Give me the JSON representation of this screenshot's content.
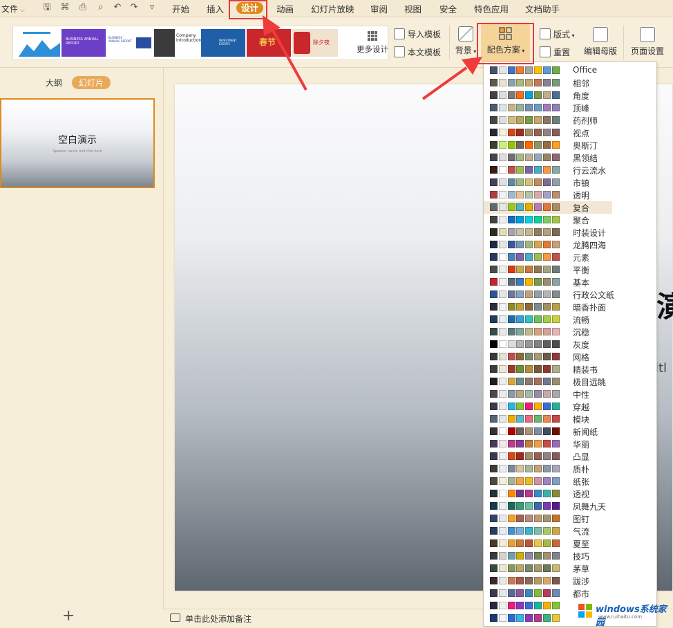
{
  "menubar": {
    "file_label": "文件",
    "items": [
      "开始",
      "插入",
      "设计",
      "动画",
      "幻灯片放映",
      "审阅",
      "视图",
      "安全",
      "特色应用",
      "文档助手"
    ],
    "active_item": "设计"
  },
  "ribbon": {
    "templates": [
      {
        "bg": "#ffffff",
        "accent": "#2f8fd8"
      },
      {
        "bg": "#6c3fc7",
        "accent": "#b48cf0",
        "text": "BUSINESS ANNUAL REPORT"
      },
      {
        "bg": "#ffffff",
        "accent": "#2b4ea0",
        "text": "BUSINESS ANNUAL REPORT"
      },
      {
        "bg": "#3b3b3b",
        "accent": "#ffffff",
        "text": "Company Introduction"
      },
      {
        "bg": "#1f5fa8",
        "accent": "#5fb0e8",
        "text": "INVESTMENT EVENTS"
      },
      {
        "bg": "#c9272c",
        "accent": "#f6c24a",
        "text": "春节"
      },
      {
        "bg": "#f0e2cf",
        "accent": "#c9272c",
        "text": "除夕夜"
      }
    ],
    "more_design": "更多设计",
    "import_template": "导入模板",
    "text_template": "本文模板",
    "background": "背景",
    "color_scheme": "配色方案",
    "layout": "版式",
    "reset": "重置",
    "edit_master": "编辑母版",
    "page_setup": "页面设置"
  },
  "left_pane": {
    "tab_outline": "大纲",
    "tab_slides": "幻灯片",
    "thumb_title": "空白演示",
    "thumb_subtitle": "Speaker name and title here",
    "add_icon": "plus-icon"
  },
  "slide_edge_text1": "演",
  "slide_edge_text2": "itl",
  "notes_placeholder": "单击此处添加备注",
  "watermark": {
    "text": "windows系统家园",
    "url": "www.ruihaitu.com"
  },
  "color_schemes": [
    {
      "name": "Office",
      "colors": [
        "#44546a",
        "#e7e6e6",
        "#4472c4",
        "#ed7d31",
        "#a5a5a5",
        "#ffc000",
        "#5b9bd5",
        "#70ad47"
      ]
    },
    {
      "name": "相邻",
      "colors": [
        "#5d5b4f",
        "#e8e3cf",
        "#8aa2a9",
        "#a9b97a",
        "#c4a776",
        "#c27a58",
        "#8a7f93",
        "#7a9a7a"
      ]
    },
    {
      "name": "角度",
      "colors": [
        "#434242",
        "#dddddd",
        "#797b7e",
        "#f96a1b",
        "#08a1d9",
        "#7c984a",
        "#c2ad8d",
        "#506e94"
      ]
    },
    {
      "name": "顶峰",
      "colors": [
        "#4e5b6f",
        "#dfe3e5",
        "#c9b583",
        "#97b19b",
        "#7a8fb6",
        "#6e9bc1",
        "#a47ab8",
        "#8e7fb6"
      ]
    },
    {
      "name": "药剂师",
      "colors": [
        "#464646",
        "#dedede",
        "#d0bd7f",
        "#b7a85b",
        "#7c9a4c",
        "#c6a86a",
        "#8c7561",
        "#6a7f7e"
      ]
    },
    {
      "name": "视点",
      "colors": [
        "#292934",
        "#f3f2dc",
        "#d34817",
        "#9b2d1f",
        "#a28e6a",
        "#956251",
        "#918485",
        "#855d5d"
      ]
    },
    {
      "name": "奥斯汀",
      "colors": [
        "#3e3d2d",
        "#caf278",
        "#94c600",
        "#71685a",
        "#ff6700",
        "#909465",
        "#956b43",
        "#fea022"
      ]
    },
    {
      "name": "黑领结",
      "colors": [
        "#46464a",
        "#dddddd",
        "#6f6f74",
        "#a7b789",
        "#beae98",
        "#92a9b9",
        "#9c8265",
        "#8d6974"
      ]
    },
    {
      "name": "行云流水",
      "colors": [
        "#3a1e12",
        "#ffffff",
        "#c0504d",
        "#9bbb59",
        "#8064a2",
        "#4bacc6",
        "#f79646",
        "#8ba8a8"
      ]
    },
    {
      "name": "市镇",
      "colors": [
        "#424456",
        "#dee0e5",
        "#5d8aa8",
        "#a2b97e",
        "#d4c07f",
        "#c38d5c",
        "#7e6b96",
        "#93a0a8"
      ]
    },
    {
      "name": "透明",
      "colors": [
        "#b13f3f",
        "#f2f2f2",
        "#9fb8cd",
        "#e8c19b",
        "#b1c5a0",
        "#d9a9a9",
        "#a6a2c8",
        "#bb8f6a"
      ]
    },
    {
      "name": "复合",
      "colors": [
        "#5c6b6f",
        "#e3e7e8",
        "#98c723",
        "#59b0b9",
        "#deae00",
        "#b77bb4",
        "#e0773c",
        "#a98d63"
      ]
    },
    {
      "name": "聚合",
      "colors": [
        "#424242",
        "#eeeeee",
        "#0f6fc6",
        "#009dd9",
        "#0bd0d9",
        "#10cf9b",
        "#7cca62",
        "#a5c249"
      ]
    },
    {
      "name": "时装设计",
      "colors": [
        "#2f2b20",
        "#dfdcb7",
        "#a5a5a5",
        "#c9c2a6",
        "#c4b690",
        "#8e7f5f",
        "#b0a281",
        "#7a6a52"
      ]
    },
    {
      "name": "龙腾四海",
      "colors": [
        "#1f2a44",
        "#e7e6e6",
        "#3b5998",
        "#7896b8",
        "#a3b47d",
        "#d5a64b",
        "#e07b39",
        "#c8a07a"
      ]
    },
    {
      "name": "元素",
      "colors": [
        "#2a3a59",
        "#ffffff",
        "#4f81bd",
        "#8064a2",
        "#4bacc6",
        "#9bbb59",
        "#f79646",
        "#c0504d"
      ]
    },
    {
      "name": "平衡",
      "colors": [
        "#4c4c4c",
        "#eeeeee",
        "#d43d1a",
        "#c9a74a",
        "#c47b3c",
        "#8d7a5c",
        "#a8a282",
        "#6f7d7a"
      ]
    },
    {
      "name": "基本",
      "colors": [
        "#c0282c",
        "#f2f2f2",
        "#5c6a7a",
        "#3d7ab8",
        "#f4b400",
        "#7a9c4a",
        "#9b8c72",
        "#8aa4a5"
      ]
    },
    {
      "name": "行政公文纸",
      "colors": [
        "#2f5597",
        "#e7e6e6",
        "#6b7b96",
        "#8aa1c1",
        "#c6a07a",
        "#8ea0a8",
        "#b3b3b3",
        "#7f8c8d"
      ]
    },
    {
      "name": "暗香扑面",
      "colors": [
        "#2e2e38",
        "#f2f2f2",
        "#8c8c2b",
        "#bf9f3a",
        "#8c6a3a",
        "#7a8c8c",
        "#a58f5f",
        "#b9a14a"
      ]
    },
    {
      "name": "流畅",
      "colors": [
        "#1f3f5a",
        "#e8eef2",
        "#1e6ea7",
        "#39a0d6",
        "#32c4c0",
        "#6fc25a",
        "#a5ce42",
        "#c9d23a"
      ]
    },
    {
      "name": "沉稳",
      "colors": [
        "#3b4b49",
        "#e8e8e8",
        "#5b7c7a",
        "#7fa89a",
        "#c0b88a",
        "#d4a27f",
        "#d79f9f",
        "#eab3b3"
      ]
    },
    {
      "name": "灰度",
      "colors": [
        "#000000",
        "#ffffff",
        "#dddddd",
        "#b2b2b2",
        "#969696",
        "#808080",
        "#5f5f5f",
        "#4d4d4d"
      ]
    },
    {
      "name": "网格",
      "colors": [
        "#3a3a3a",
        "#e6e1d6",
        "#c0504d",
        "#8c6a3a",
        "#7a8c6e",
        "#a59a7a",
        "#6b5b4b",
        "#8c3c3c"
      ]
    },
    {
      "name": "精装书",
      "colors": [
        "#3c3c3c",
        "#eee8d5",
        "#9d3a2a",
        "#6b8f3a",
        "#b98c3c",
        "#7a5a3a",
        "#8c3a2a",
        "#a8b08a"
      ]
    },
    {
      "name": "极目远眺",
      "colors": [
        "#1f1f1f",
        "#eeeeee",
        "#d9a63a",
        "#6e8c8c",
        "#8c7a6a",
        "#a86e5a",
        "#6e7a8c",
        "#9a8c6e"
      ]
    },
    {
      "name": "中性",
      "colors": [
        "#4e4a4a",
        "#ecebea",
        "#8a9aa8",
        "#b8a88a",
        "#a8b8a8",
        "#9a8aa8",
        "#c8a8a8",
        "#a8a8a8"
      ]
    },
    {
      "name": "穿越",
      "colors": [
        "#3a3a4a",
        "#e8e8ee",
        "#2ab5e0",
        "#86c23a",
        "#e81f7a",
        "#f4b10a",
        "#3a6ed4",
        "#20b39c"
      ]
    },
    {
      "name": "模块",
      "colors": [
        "#5a6378",
        "#e4e6ea",
        "#f0ad00",
        "#60b5cc",
        "#e66c7d",
        "#6bb76d",
        "#e88651",
        "#c64847"
      ]
    },
    {
      "name": "新闻纸",
      "colors": [
        "#333333",
        "#ffffff",
        "#ad0101",
        "#726056",
        "#ac956e",
        "#808da9",
        "#424e5b",
        "#730e00"
      ]
    },
    {
      "name": "华丽",
      "colors": [
        "#4a3a5a",
        "#f2e8ee",
        "#be3a8a",
        "#8a3a9a",
        "#c87a3a",
        "#e8a04a",
        "#c84a4a",
        "#9a6ab8"
      ]
    },
    {
      "name": "凸显",
      "colors": [
        "#3b3b4b",
        "#f0f0f0",
        "#d34817",
        "#9b2d1f",
        "#a28e6a",
        "#956251",
        "#918485",
        "#855d5d"
      ]
    },
    {
      "name": "质朴",
      "colors": [
        "#3e3d3a",
        "#eeeeee",
        "#7c8a9a",
        "#d4c49a",
        "#a8b89a",
        "#c8a07a",
        "#8a9aa8",
        "#a8a8b8"
      ]
    },
    {
      "name": "纸张",
      "colors": [
        "#4a4a3a",
        "#f5efd8",
        "#a5b592",
        "#f3a447",
        "#e7bc29",
        "#d092a7",
        "#9c85c0",
        "#809ec2"
      ]
    },
    {
      "name": "透视",
      "colors": [
        "#283138",
        "#ffffff",
        "#ff8600",
        "#6a3a8a",
        "#b43a8a",
        "#3a8ac8",
        "#3ab4a8",
        "#8a8a3a"
      ]
    },
    {
      "name": "凤舞九天",
      "colors": [
        "#1a3a4a",
        "#e8f0f0",
        "#1a6a5a",
        "#3a9a7a",
        "#6ac0a0",
        "#3a6aa8",
        "#7a3ab4",
        "#5a1a8a"
      ]
    },
    {
      "name": "图钉",
      "colors": [
        "#31456a",
        "#e5e9ee",
        "#f0a22e",
        "#a5644e",
        "#b58b80",
        "#c3986d",
        "#a19574",
        "#c17529"
      ]
    },
    {
      "name": "气流",
      "colors": [
        "#2c3c5a",
        "#e8ecf2",
        "#4a90c8",
        "#7ab0d8",
        "#3ab4c8",
        "#7ac0a8",
        "#a8c86a",
        "#c8a84a"
      ]
    },
    {
      "name": "夏至",
      "colors": [
        "#4a3a2a",
        "#f5ecd8",
        "#e8a03a",
        "#c87a3a",
        "#b8583a",
        "#e8c84a",
        "#a8b84a",
        "#c8683a"
      ]
    },
    {
      "name": "技巧",
      "colors": [
        "#3b3b3b",
        "#d4d2d0",
        "#6ea0b0",
        "#ccaf0a",
        "#8d89a4",
        "#748560",
        "#9e9273",
        "#7e848d"
      ]
    },
    {
      "name": "茅草",
      "colors": [
        "#3a4a3a",
        "#ebe8d8",
        "#8a9a5a",
        "#b8a86a",
        "#7a8a6a",
        "#a89a6a",
        "#6a7a5a",
        "#c8b87a"
      ]
    },
    {
      "name": "跋涉",
      "colors": [
        "#3a2a2a",
        "#ece8e0",
        "#c87a5a",
        "#a85a4a",
        "#8a6a5a",
        "#b8986a",
        "#d8a86a",
        "#7a5a4a"
      ]
    },
    {
      "name": "都市",
      "colors": [
        "#3a3a4a",
        "#e8e8ec",
        "#5a6a9a",
        "#8a5a9a",
        "#3a8ab8",
        "#8ab83a",
        "#b83a5a",
        "#6a8ab8"
      ]
    },
    {
      "name": "",
      "colors": [
        "#2a2a3a",
        "#f0f0f0",
        "#e81f7a",
        "#8a3ab8",
        "#3a6ed4",
        "#20b39c",
        "#f4b10a",
        "#86c23a"
      ]
    },
    {
      "name": "",
      "colors": [
        "#1a3a6a",
        "#f0f4f8",
        "#2a6ad4",
        "#3ab4e8",
        "#8a3ab8",
        "#b43a8a",
        "#3ab47a",
        "#e8c83a"
      ]
    }
  ],
  "selected_scheme": "复合"
}
